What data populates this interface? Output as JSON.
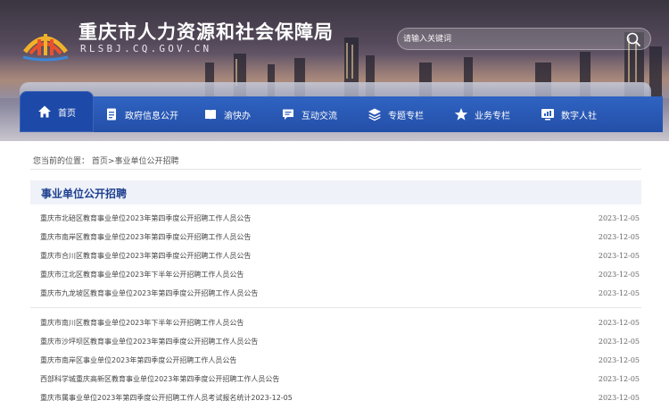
{
  "header": {
    "title": "重庆市人力资源和社会保障局",
    "domain": "RLSBJ.CQ.GOV.CN",
    "search_placeholder": "请输入关键词"
  },
  "nav": [
    {
      "label": "首页",
      "icon": "home-icon",
      "active": true
    },
    {
      "label": "政府信息公开",
      "icon": "document-icon"
    },
    {
      "label": "渝快办",
      "icon": "book-icon"
    },
    {
      "label": "互动交流",
      "icon": "chat-icon"
    },
    {
      "label": "专题专栏",
      "icon": "layers-icon"
    },
    {
      "label": "业务专栏",
      "icon": "star-icon"
    },
    {
      "label": "数字人社",
      "icon": "chart-monitor-icon"
    }
  ],
  "breadcrumb": {
    "prefix": "您当前的位置：",
    "home": "首页",
    "sep": ">",
    "current": "事业单位公开招聘"
  },
  "section": {
    "title": "事业单位公开招聘"
  },
  "list1": [
    {
      "title": "重庆市北碚区教育事业单位2023年第四季度公开招聘工作人员公告",
      "date": "2023-12-05"
    },
    {
      "title": "重庆市南岸区教育事业单位2023年第四季度公开招聘工作人员公告",
      "date": "2023-12-05"
    },
    {
      "title": "重庆市合川区教育事业单位2023年第四季度公开招聘工作人员公告",
      "date": "2023-12-05"
    },
    {
      "title": "重庆市江北区教育事业单位2023年下半年公开招聘工作人员公告",
      "date": "2023-12-05"
    },
    {
      "title": "重庆市九龙坡区教育事业单位2023年第四季度公开招聘工作人员公告",
      "date": "2023-12-05"
    }
  ],
  "list2": [
    {
      "title": "重庆市南川区教育事业单位2023年下半年公开招聘工作人员公告",
      "date": "2023-12-05"
    },
    {
      "title": "重庆市沙坪坝区教育事业单位2023年第四季度公开招聘工作人员公告",
      "date": "2023-12-05"
    },
    {
      "title": "重庆市南岸区事业单位2023年第四季度公开招聘工作人员公告",
      "date": "2023-12-05"
    },
    {
      "title": "西部科学城重庆高新区教育事业单位2023年第四季度公开招聘工作人员公告",
      "date": "2023-12-05"
    },
    {
      "title": "重庆市属事业单位2023年第四季度公开招聘工作人员考试报名统计2023-12-05",
      "date": "2023-12-05"
    }
  ],
  "colors": {
    "nav_blue": "#2f63c2",
    "nav_active": "#1d49a8",
    "section_title": "#1d3f8f"
  }
}
